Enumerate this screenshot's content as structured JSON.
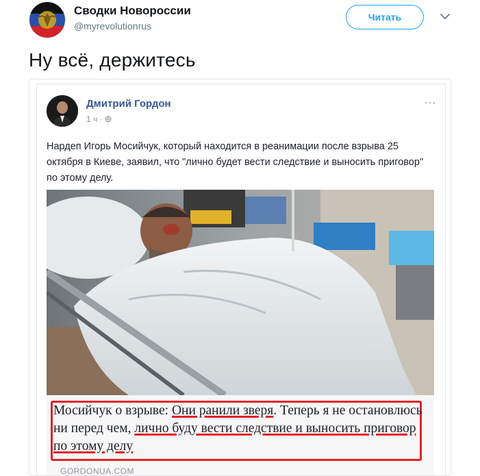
{
  "tweet": {
    "author_name": "Сводки Новороссии",
    "author_handle": "@myrevolutionrus",
    "follow_label": "Читать",
    "text": "Ну всё, держитесь"
  },
  "fb_post": {
    "author_name": "Дмитрий Гордон",
    "time": "1 ч",
    "more_label": "···",
    "text": "Нардеп Игорь Мосийчук, который находится в реанимации после взрыва 25 октября в Киеве, заявил, что \"лично будет вести следствие и выносить приговор\" по этому делу.",
    "quote": {
      "part1": "Мосийчук о взрыве: ",
      "part2": "Они ранили зверя",
      "part3": ". Теперь я не остановлюсь ни перед чем, ",
      "part4": "лично буду вести следствие и выносить приговор по этому делу"
    },
    "source": "GORDONUA.COM"
  },
  "colors": {
    "accent": "#1da1f2",
    "fb_name": "#365899",
    "highlight": "#e0202a"
  },
  "icons": [
    "dnr-emblem-avatar",
    "chevron-down-icon",
    "globe-icon",
    "more-icon"
  ]
}
